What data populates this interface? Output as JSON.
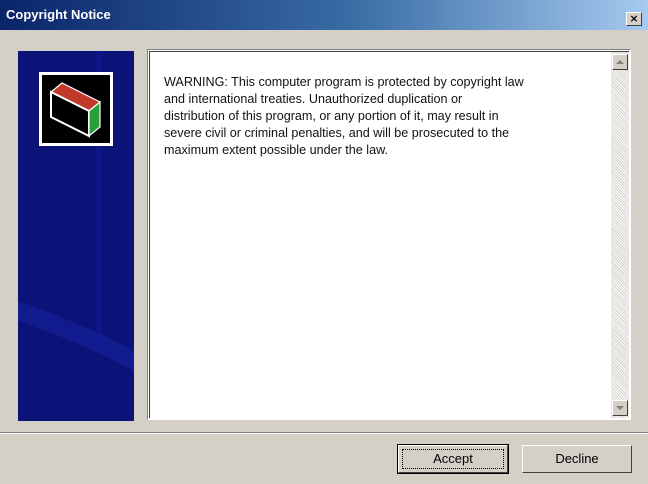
{
  "window": {
    "title": "Copyright Notice",
    "close_glyph": "×"
  },
  "side_panel": {
    "logo_icon": "product-box-icon",
    "background_color": "#0b1278"
  },
  "notice": {
    "text": "WARNING: This computer program is protected by copyright law\nand international treaties. Unauthorized duplication or\ndistribution of this program, or any portion of it, may result in\nsevere civil or criminal penalties, and will be prosecuted to the\nmaximum extent possible under the law."
  },
  "buttons": {
    "accept_label": "Accept",
    "decline_label": "Decline"
  },
  "colors": {
    "titlebar_start": "#0a246a",
    "titlebar_end": "#a6caf0",
    "dialog_face": "#d4d0c8"
  }
}
